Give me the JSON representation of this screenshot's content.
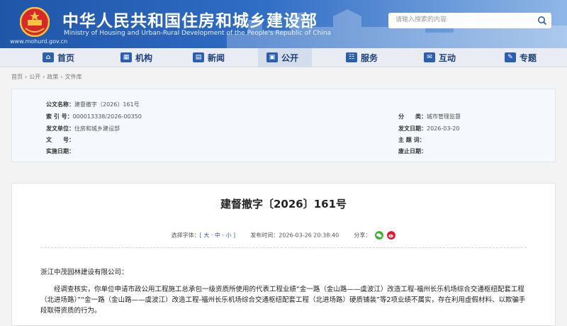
{
  "header": {
    "title_cn": "中华人民共和国住房和城乡建设部",
    "title_en": "Ministry of Housing and Urban-Rural Development of the People's Republic of China",
    "url": "www.mohurd.gov.cn",
    "search_placeholder": "请输入搜索的内容",
    "brand_color": "#2560b5"
  },
  "nav": [
    {
      "label": "首页",
      "icon": "home-icon"
    },
    {
      "label": "机构",
      "icon": "org-icon"
    },
    {
      "label": "新闻",
      "icon": "news-icon"
    },
    {
      "label": "公开",
      "icon": "open-icon",
      "active": true
    },
    {
      "label": "服务",
      "icon": "service-icon"
    },
    {
      "label": "互动",
      "icon": "interact-icon"
    },
    {
      "label": "专题",
      "icon": "topic-icon"
    }
  ],
  "breadcrumb": [
    "首页",
    "公开",
    "政策",
    "文件库"
  ],
  "info": {
    "doc_name_label": "公文名称：",
    "doc_name": "建督撤字〔2026〕161号",
    "index_label": "索 引 号：",
    "index": "000013338/2026-00350",
    "category_label": "分　　类：",
    "category": "城市管理监督",
    "issuer_label": "发文单位：",
    "issuer": "住房和城乡建设部",
    "date_label": "发文日期：",
    "date": "2026-03-20",
    "docno_label": "文　　号：",
    "docno": "",
    "subject_label": "主 题 词：",
    "subject": "",
    "effective_label": "实施日期：",
    "effective": "",
    "expire_label": "废止日期：",
    "expire": ""
  },
  "article": {
    "title": "建督撤字〔2026〕161号",
    "font_label": "选择字体：",
    "font_options": "[ 大 · 中 · 小 ]",
    "publish_label": "发布时间：",
    "publish_time": "2026-03-26 20:38:40",
    "share_label": "分享：",
    "addressee": "浙江中茂园林建设有限公司：",
    "body1": "经调查核实，你单位申请市政公用工程施工总承包一级资质所使用的代表工程业绩“金一路（金山路——虞波江）改造工程-福州长乐机场综合交通枢纽配套工程（北进场路）”“金一路（金山路——虞波江）改造工程-福州长乐机场综合交通枢纽配套工程（北进场路）硬质铺装”等2项业绩不属实，存在利用虚假材料、以欺骗手段取得资质的行为。"
  }
}
